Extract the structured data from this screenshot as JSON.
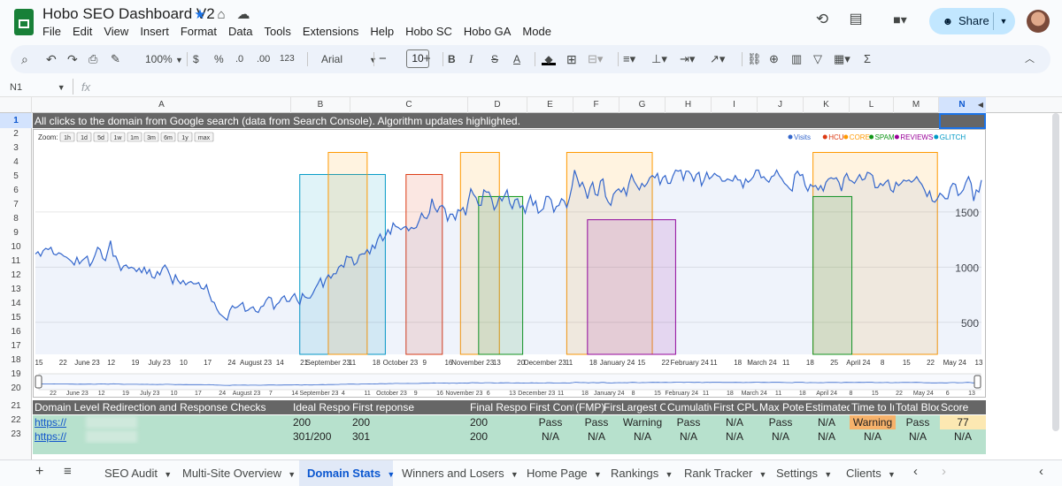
{
  "doc": {
    "title": "Hobo SEO Dashboard V2",
    "menus": [
      "File",
      "Edit",
      "View",
      "Insert",
      "Format",
      "Data",
      "Tools",
      "Extensions",
      "Help",
      "Hobo SC",
      "Hobo GA",
      "Mode"
    ],
    "share_label": "Share"
  },
  "toolbar": {
    "zoom": "100%",
    "currency": "$",
    "percent": "%",
    "dec_decrease": ".0",
    "dec_increase": ".00",
    "number_format": "123",
    "font": "Arial",
    "font_size": "10"
  },
  "formula_bar": {
    "name_box": "N1",
    "fx": "fx"
  },
  "columns": [
    "A",
    "B",
    "C",
    "D",
    "E",
    "F",
    "G",
    "H",
    "I",
    "J",
    "K",
    "L",
    "M",
    "N"
  ],
  "rows": [
    "1",
    "2",
    "3",
    "4",
    "5",
    "6",
    "7",
    "8",
    "9",
    "10",
    "11",
    "12",
    "13",
    "14",
    "15",
    "16",
    "17",
    "18",
    "19",
    "20",
    "21",
    "22",
    "23"
  ],
  "row1_text": "All clicks to the domain from Google search (data from Search Console). Algorithm updates highlighted.",
  "chart_data": {
    "type": "line",
    "zoom_label": "Zoom:",
    "zoom_buttons": [
      "1h",
      "1d",
      "5d",
      "1w",
      "1m",
      "3m",
      "6m",
      "1y",
      "max"
    ],
    "legend": [
      {
        "name": "Visits",
        "color": "#3366cc"
      },
      {
        "name": "HCU",
        "color": "#dc3912"
      },
      {
        "name": "CORE",
        "color": "#ff9900"
      },
      {
        "name": "SPAM",
        "color": "#109618"
      },
      {
        "name": "REVIEWS",
        "color": "#990099"
      },
      {
        "name": "GLITCH",
        "color": "#0099c6"
      }
    ],
    "y_ticks": [
      500,
      1000,
      1500
    ],
    "x_ticks": [
      "15",
      "22",
      "June 23",
      "12",
      "19",
      "July 23",
      "10",
      "17",
      "24",
      "August 23",
      "14",
      "21",
      "September 23",
      "11",
      "18",
      "October 23",
      "9",
      "16",
      "November 23",
      "13",
      "20",
      "December 23",
      "11",
      "18",
      "January 24",
      "15",
      "22",
      "February 24",
      "11",
      "18",
      "March 24",
      "11",
      "18",
      "25",
      "April 24",
      "8",
      "15",
      "22",
      "May 24",
      "13"
    ],
    "nav_ticks": [
      "22",
      "June 23",
      "12",
      "19",
      "July 23",
      "10",
      "17",
      "24",
      "August 23",
      "7",
      "14",
      "September 23",
      "4",
      "11",
      "October 23",
      "9",
      "16",
      "November 23",
      "6",
      "13",
      "December 23",
      "11",
      "18",
      "January 24",
      "8",
      "15",
      "February 24",
      "11",
      "18",
      "March 24",
      "11",
      "18",
      "April 24",
      "8",
      "15",
      "22",
      "May 24",
      "6",
      "13"
    ],
    "update_periods": [
      {
        "type": "GLITCH",
        "color": "#0099c6",
        "start": "2023-08-25",
        "end": "2023-09-27",
        "peak": 1840
      },
      {
        "type": "CORE",
        "color": "#ff9900",
        "start": "2023-09-05",
        "end": "2023-09-20",
        "peak": 2040
      },
      {
        "type": "HCU",
        "color": "#dc3912",
        "start": "2023-10-05",
        "end": "2023-10-19",
        "peak": 1840
      },
      {
        "type": "CORE",
        "color": "#ff9900",
        "start": "2023-10-26",
        "end": "2023-11-10",
        "peak": 2040
      },
      {
        "type": "SPAM",
        "color": "#109618",
        "start": "2023-11-02",
        "end": "2023-11-19",
        "peak": 1640
      },
      {
        "type": "CORE",
        "color": "#ff9900",
        "start": "2023-12-06",
        "end": "2024-01-08",
        "peak": 2040
      },
      {
        "type": "REVIEWS",
        "color": "#990099",
        "start": "2023-12-14",
        "end": "2024-01-17",
        "peak": 1430
      },
      {
        "type": "CORE",
        "color": "#ff9900",
        "start": "2024-03-10",
        "end": "2024-04-27",
        "peak": 2040
      },
      {
        "type": "SPAM",
        "color": "#109618",
        "start": "2024-03-10",
        "end": "2024-03-25",
        "peak": 1640
      }
    ],
    "series": [
      {
        "name": "Visits",
        "color": "#3366cc",
        "values": [
          1120,
          1140,
          1100,
          1150,
          1170,
          1160,
          1180,
          1120,
          1110,
          1130,
          1120,
          1100,
          1090,
          1070,
          1050,
          1020,
          1090,
          1030,
          1060,
          1080,
          1100,
          1010,
          1050,
          1110,
          1180,
          1160,
          1080,
          1060,
          1150,
          1240,
          1100,
          1100,
          1040,
          970,
          1010,
          1020,
          990,
          1000,
          990,
          960,
          990,
          950,
          1000,
          940,
          980,
          910,
          900,
          960,
          930,
          990,
          1020,
          980,
          920,
          850,
          930,
          880,
          850,
          880,
          840,
          860,
          870,
          850,
          850,
          860,
          810,
          800,
          840,
          760,
          690,
          680,
          620,
          580,
          560,
          540,
          520,
          610,
          650,
          630,
          640,
          660,
          680,
          600,
          610,
          630,
          640,
          600,
          590,
          640,
          650,
          700,
          730,
          720,
          620,
          660,
          680,
          720,
          740,
          690,
          690,
          730,
          760,
          700,
          660,
          760,
          730,
          720,
          720,
          760,
          810,
          850,
          900,
          820,
          890,
          930,
          900,
          940,
          940,
          1000,
          1020,
          1000,
          1100,
          1090,
          1090,
          1020,
          1040,
          1110,
          1120,
          1120,
          1160,
          1120,
          1200,
          1170,
          1250,
          1300,
          1240,
          1280,
          1340,
          1300,
          1400,
          1370,
          1360,
          1340,
          1360,
          1370,
          1330,
          1360,
          1350,
          1360,
          1420,
          1490,
          1450,
          1440,
          1490,
          1620,
          1540,
          1500,
          1550,
          1560,
          1530,
          1420,
          1480,
          1480,
          1430,
          1520,
          1510,
          1540,
          1470,
          1600,
          1710,
          1660,
          1630,
          1560,
          1560,
          1700,
          1680,
          1680,
          1620,
          1520,
          1560,
          1640,
          1600,
          1650,
          1700,
          1580,
          1530,
          1610,
          1620,
          1540,
          1560,
          1490,
          1580,
          1650,
          1560,
          1600,
          1490,
          1510,
          1530,
          1640,
          1640,
          1610,
          1500,
          1550,
          1560,
          1620,
          1600,
          1540,
          1620,
          1730,
          1880,
          1810,
          1730,
          1770,
          1710,
          1620,
          1720,
          1770,
          1660,
          1650,
          1780,
          1800,
          1640,
          1590,
          1560,
          1660,
          1690,
          1710,
          1680,
          1720,
          1650,
          1760,
          1840,
          1780,
          1740,
          1700,
          1760,
          1730,
          1760,
          1810,
          1830,
          1810,
          1850,
          1750,
          1810,
          1830,
          1760,
          1760,
          1830,
          1880,
          1870,
          1880,
          1790,
          1870,
          1870,
          1840,
          1780,
          1840,
          1860,
          1740,
          1790,
          1860,
          1800,
          1820,
          1850,
          1830,
          1820,
          1780,
          1780,
          1800,
          1790,
          1780,
          1830,
          1790,
          1790,
          1720,
          1800,
          1770,
          1790,
          1820,
          1880,
          1880,
          1810,
          1820,
          1790,
          1770,
          1820,
          1830,
          1880,
          1830,
          1800,
          1760,
          1740,
          1710,
          1690,
          1840,
          1870,
          1830,
          1840,
          1740,
          1690,
          1750,
          1730,
          1740,
          1700,
          1740,
          1690,
          1770,
          1800,
          1810,
          1800,
          1810,
          1770,
          1690,
          1810,
          1850,
          1790,
          1780,
          1760,
          1800,
          1840,
          1790,
          1800,
          1860,
          1850,
          1830,
          1720,
          1720,
          1760,
          1740,
          1770,
          1790,
          1700,
          1680,
          1770,
          1740,
          1760,
          1790,
          1780,
          1790,
          1770,
          1790,
          1820,
          1780,
          1750,
          1700,
          1640,
          1690,
          1600,
          1590,
          1620,
          1670,
          1650,
          1620,
          1620,
          1720,
          1760,
          1750,
          1650,
          1670,
          1700,
          1770,
          1820,
          1760,
          1600,
          1700,
          1680,
          1790
        ]
      }
    ]
  },
  "table": {
    "headers": [
      "Domain Level Redirection and Response Checks",
      "Ideal Respons",
      "First reponse",
      "Final Respons",
      "First Conte",
      "(FMP)",
      "Firs",
      "Largest Co",
      "Cumulativ",
      "First CPU",
      "Max Poten",
      "Estimated",
      "Time to Int",
      "Total Block",
      "Score"
    ],
    "rows": [
      [
        "https://",
        "200",
        "200",
        "200",
        "Pass",
        "Pass",
        "Warning",
        "Pass",
        "N/A",
        "Pass",
        "N/A",
        "Warning",
        "Pass",
        "77"
      ],
      [
        "https://",
        "301/200",
        "301",
        "200",
        "N/A",
        "N/A",
        "N/A",
        "N/A",
        "N/A",
        "N/A",
        "N/A",
        "N/A",
        "N/A",
        "N/A"
      ]
    ],
    "warning_color": "#f6b26b",
    "score_color": "#fce8b2"
  },
  "tabs": [
    "SEO Audit",
    "Multi-Site Overview",
    "Domain Stats",
    "Winners and Losers",
    "Home Page",
    "Rankings",
    "Rank Tracker",
    "Settings",
    "Clients"
  ],
  "active_tab": "Domain Stats"
}
